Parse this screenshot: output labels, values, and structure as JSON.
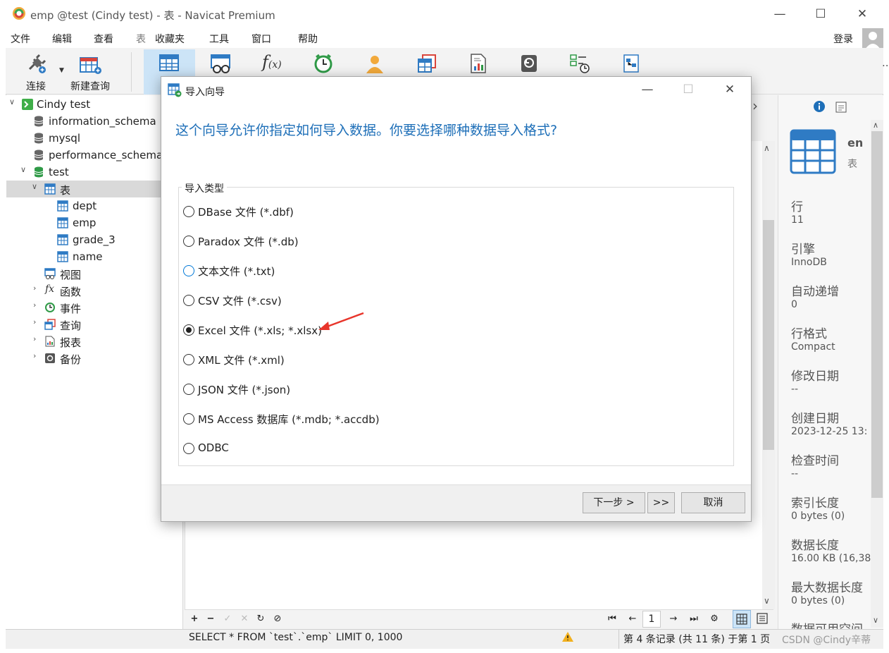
{
  "app": {
    "title": "emp @test (Cindy test) - 表 - Navicat Premium",
    "login_label": "登录"
  },
  "menu": [
    "文件",
    "编辑",
    "查看",
    "表",
    "收藏夹",
    "工具",
    "窗口",
    "帮助"
  ],
  "toolbar": {
    "connect_label": "连接",
    "new_query_label": "新建查询"
  },
  "sidebar": {
    "connection": "Cindy test",
    "databases": [
      "information_schema",
      "mysql",
      "performance_schema",
      "test"
    ],
    "tables_folder": "表",
    "tables": [
      "dept",
      "emp",
      "grade_3",
      "name"
    ],
    "objects": [
      "视图",
      "函数",
      "事件",
      "查询",
      "报表",
      "备份"
    ]
  },
  "info_panel": {
    "name": "en",
    "type": "表",
    "fields": [
      {
        "label": "行",
        "value": "11"
      },
      {
        "label": "引擎",
        "value": "InnoDB"
      },
      {
        "label": "自动递增",
        "value": "0"
      },
      {
        "label": "行格式",
        "value": "Compact"
      },
      {
        "label": "修改日期",
        "value": "--"
      },
      {
        "label": "创建日期",
        "value": "2023-12-25 13:"
      },
      {
        "label": "检查时间",
        "value": "--"
      },
      {
        "label": "索引长度",
        "value": "0 bytes (0)"
      },
      {
        "label": "数据长度",
        "value": "16.00 KB (16,38"
      },
      {
        "label": "最大数据长度",
        "value": "0 bytes (0)"
      },
      {
        "label": "数据可用空间",
        "value": ""
      }
    ]
  },
  "bottom_nav": {
    "page": "1"
  },
  "status": {
    "sql": "SELECT * FROM `test`.`emp` LIMIT 0, 1000",
    "record_info": "第 4 条记录 (共 11 条) 于第 1 页",
    "watermark": "CSDN @Cindy辛蒂"
  },
  "dialog": {
    "title": "导入向导",
    "heading": "这个向导允许你指定如何导入数据。你要选择哪种数据导入格式?",
    "group_label": "导入类型",
    "options": [
      "DBase 文件 (*.dbf)",
      "Paradox 文件 (*.db)",
      "文本文件 (*.txt)",
      "CSV 文件 (*.csv)",
      "Excel 文件 (*.xls; *.xlsx)",
      "XML 文件 (*.xml)",
      "JSON 文件 (*.json)",
      "MS Access 数据库 (*.mdb; *.accdb)",
      "ODBC"
    ],
    "selected_option": "Excel 文件 (*.xls; *.xlsx)",
    "next_label": "下一步 >",
    "finish_label": ">>",
    "cancel_label": "取消"
  },
  "colors": {
    "heading": "#1e6fb8",
    "table_icon": "#2f7bc4",
    "arrow": "#e8352b"
  }
}
